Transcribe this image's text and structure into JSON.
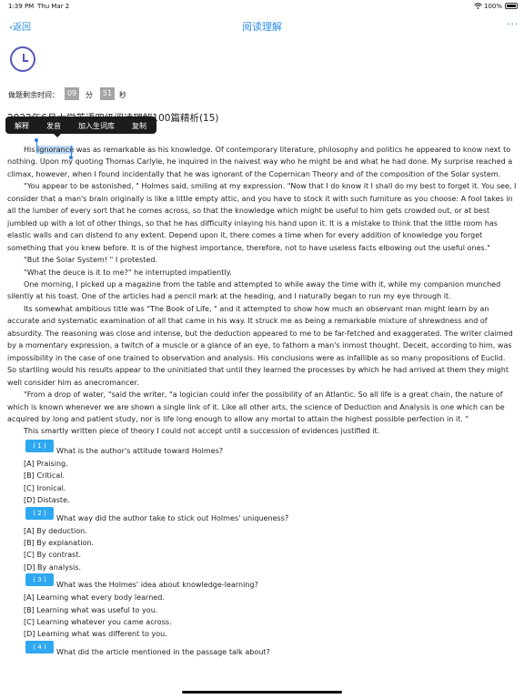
{
  "status": {
    "time": "1:39 PM",
    "date": "Thu Mar 2",
    "battery": "100%"
  },
  "nav": {
    "back": "返回",
    "title": "阅读理解",
    "more": "···"
  },
  "timer": {
    "label": "做题剩余时间：",
    "minutes": "09",
    "min_unit": "分",
    "seconds": "51",
    "sec_unit": "秒"
  },
  "title": "2022年6月大学英语四级阅读理解100篇精析(15)",
  "popup": {
    "items": [
      "解释",
      "发音",
      "加入生词库",
      "复制"
    ]
  },
  "passage": {
    "p1_sel": "ignorance",
    "p1_pre": "His ",
    "p1_rest": " was as remarkable as his knowledge. Of contemporary literature, philosophy and politics he appeared to know next to nothing. Upon my quoting Thomas Carlyle, he inquired in the naivest way who he might be and what he had done. My surprise reached a climax, however, when I found incidentally that he was ignorant of the Copernican Theory and of the composition of the Solar system.",
    "p2": "\"You appear to be astonished, \" Holmes said, smiling at my expression. \"Now that I do know it I shall do my best to forget it. You see, I consider that a man's brain originally is like a little empty attic, and you have to stock it with such furniture as you choose: A fool takes in all the lumber of every sort that he comes across, so that the knowledge which might be useful to him gets crowded out, or at best jumbled up with a lot of other things, so that he has difficulty inlaying his hand upon it. It is a mistake to think that the little room has elastic walls and can distend to any extent. Depend upon it, there comes a time when for every addition of knowledge you forget something that you knew before. It is of the highest importance, therefore, not to have useless facts elbowing out the useful ones.\"",
    "p3": "\"But the Solar System! \" I protested.",
    "p4": "\"What the deuce is it to me?\" he interrupted impatiently.",
    "p5": "One morning, I picked up a magazine from the table and attempted to while away the time with it, while my companion munched silently at his toast. One of the articles had a pencil mark at the heading, and I naturally began to run my eye through it.",
    "p6": "Its somewhat ambitious title was \"The Book of Life, \" and it attempted to show how much an observant man might learn by an accurate and systematic examination of all that came in his way. It struck me as being a remarkable mixture of shrewdness and of absurdity. The reasoning was close and intense, but the deduction appeared to me to be far-fetched and exaggerated. The writer claimed by a momentary expression, a twitch of a muscle or a glance of an eye, to fathom a man's inmost thought. Deceit, according to him, was impossibility in the case of one trained to observation and analysis. His conclusions were as infallible as so many propositions of Euclid. So startling would his results appear to the uninitiated that until they learned the processes by which he had arrived at them they might well consider him as anecromancer.",
    "p7": "\"From a drop of water, \"said the writer, \"a logician could infer the possibility of an Atlantic. So all life is a great chain, the nature of which is known whenever we are shown a single link of it. Like all other arts, the science of Deduction and Analysis is one which can be acquired by long and patient study, nor is life long enough to allow any mortal to attain the highest possible perfection in it. \"",
    "p8": "This smartly written piece of theory I could not accept until a succession of evidences justified it."
  },
  "questions": [
    {
      "num": "( 1 )",
      "text": "What is the author's attitude toward Holmes?",
      "options": [
        "[A] Praising.",
        "[B] Critical.",
        "[C] Ironical.",
        "[D] Distaste."
      ]
    },
    {
      "num": "( 2 )",
      "text": "What way did the author take to stick out Holmes' uniqueness?",
      "options": [
        "[A] By deduction.",
        "[B] By explanation.",
        "[C] By contrast.",
        "[D] By analysis."
      ]
    },
    {
      "num": "( 3 )",
      "text": "What was the Holmes' idea about knowledge-learning?",
      "options": [
        "[A] Learning what every body learned.",
        "[B] Learning what was useful to you.",
        "[C] Learning whatever you came across.",
        "[D] Learning what was different to you."
      ]
    },
    {
      "num": "( 4 )",
      "text": "What did the article mentioned in the passage talk about?",
      "options": []
    }
  ]
}
